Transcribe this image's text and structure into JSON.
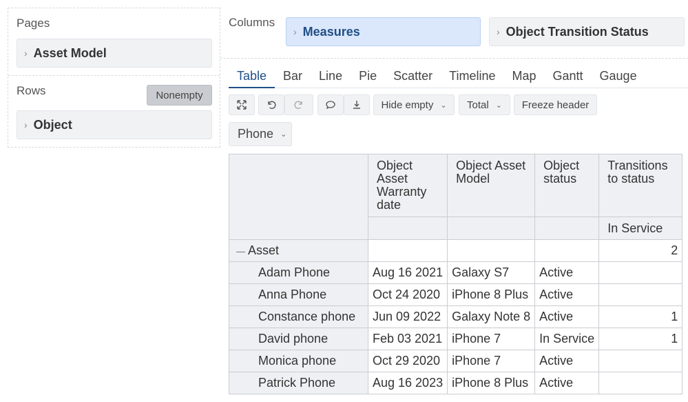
{
  "pages": {
    "label": "Pages",
    "chip": "Asset Model"
  },
  "rows": {
    "label": "Rows",
    "nonempty": "Nonempty",
    "chip": "Object"
  },
  "columns": {
    "label": "Columns",
    "chips": [
      "Measures",
      "Object Transition Status"
    ]
  },
  "tabs": [
    "Table",
    "Bar",
    "Line",
    "Pie",
    "Scatter",
    "Timeline",
    "Map",
    "Gantt",
    "Gauge"
  ],
  "toolbar": {
    "hide_empty": "Hide empty",
    "total": "Total",
    "freeze_header": "Freeze header"
  },
  "filter": {
    "phone": "Phone"
  },
  "table": {
    "headers": [
      "Object Asset Warranty date",
      "Object Asset Model",
      "Object status",
      "Transitions to status"
    ],
    "subheader_status": "In Service",
    "group": {
      "label": "Asset",
      "toggle": "—",
      "total": "2"
    },
    "rows": [
      {
        "name": "Adam Phone",
        "date": "Aug 16 2021",
        "model": "Galaxy S7",
        "status": "Active",
        "transitions": ""
      },
      {
        "name": "Anna Phone",
        "date": "Oct 24 2020",
        "model": "iPhone 8 Plus",
        "status": "Active",
        "transitions": ""
      },
      {
        "name": "Constance phone",
        "date": "Jun 09 2022",
        "model": "Galaxy Note 8",
        "status": "Active",
        "transitions": "1"
      },
      {
        "name": "David phone",
        "date": "Feb 03 2021",
        "model": "iPhone 7",
        "status": "In Service",
        "transitions": "1"
      },
      {
        "name": "Monica phone",
        "date": "Oct 29 2020",
        "model": "iPhone 7",
        "status": "Active",
        "transitions": ""
      },
      {
        "name": "Patrick Phone",
        "date": "Aug 16 2023",
        "model": "iPhone 8 Plus",
        "status": "Active",
        "transitions": ""
      }
    ]
  }
}
